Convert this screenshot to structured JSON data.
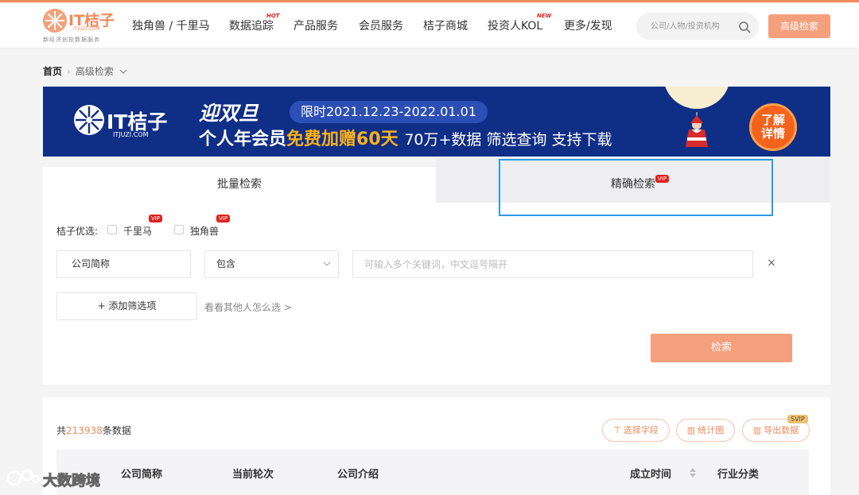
{
  "header": {
    "logo_title": "IT桔子",
    "logo_domain": "ITJUZI.COM",
    "logo_slogan": "新经济创投数据服务",
    "nav": [
      {
        "label": "独角兽 / 千里马"
      },
      {
        "label": "数据追踪",
        "badge": "HOT"
      },
      {
        "label": "产品服务"
      },
      {
        "label": "会员服务"
      },
      {
        "label": "桔子商城"
      },
      {
        "label": "投资人KOL",
        "badge": "NEW"
      },
      {
        "label": "更多/发现"
      }
    ],
    "search_placeholder": "公司/人物/投资机构",
    "advanced_search_label": "高级检索"
  },
  "breadcrumb": {
    "home": "首页",
    "sep": "›",
    "current": "高级检索"
  },
  "banner": {
    "logo_text": "IT桔子",
    "logo_domain": "ITJUZI.COM",
    "title": "迎双旦",
    "date_range": "限时2021.12.23-2022.01.01",
    "line_part1": "个人年会员",
    "line_part2": "免费加赠60天",
    "line_part3": "70万+数据 筛选查询 支持下载",
    "cta_line1": "了解",
    "cta_line2": "详情"
  },
  "search_panel": {
    "tabs": [
      {
        "label": "批量检索",
        "active": true
      },
      {
        "label": "精确检索",
        "badge": "VIP",
        "active": false
      }
    ],
    "options_label": "桔子优选:",
    "options": [
      {
        "label": "千里马",
        "badge": "VIP"
      },
      {
        "label": "独角兽",
        "badge": "VIP"
      }
    ],
    "field_value": "公司简称",
    "operator_value": "包含",
    "keyword_placeholder": "可输入多个关键词，中文逗号隔开",
    "clear_label": "×",
    "add_filter_label": "+ 添加筛选项",
    "see_others_label": "看看其他人怎么选 >",
    "submit_label": "检索"
  },
  "results": {
    "total_prefix": "共",
    "total_count": "213938",
    "total_suffix": "条数据",
    "actions": [
      {
        "label": "选择字段",
        "icon": "field-icon"
      },
      {
        "label": "统计图",
        "icon": "chart-icon"
      },
      {
        "label": "导出数据",
        "icon": "export-icon",
        "badge": "SVIP"
      }
    ],
    "columns": [
      "公司简称",
      "当前轮次",
      "公司介绍",
      "成立时间",
      "行业分类"
    ]
  },
  "watermark": {
    "text": "大数跨境"
  },
  "colors": {
    "accent": "#f08a5d",
    "button": "#f5a07c",
    "banner_bg": "#0f2e86",
    "banner_highlight": "#ffb019",
    "vip_red": "#e0221e",
    "focus_blue": "#2e9be6"
  }
}
